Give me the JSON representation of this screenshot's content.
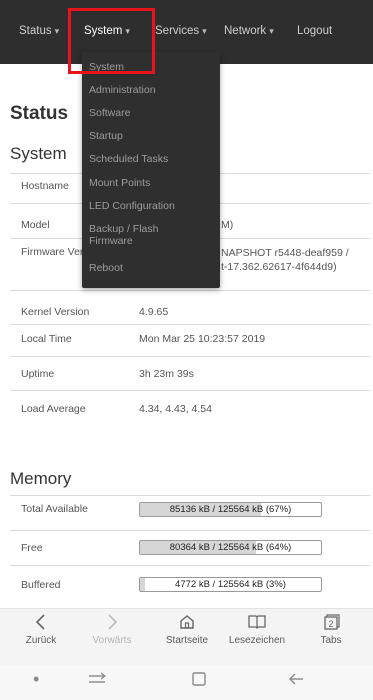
{
  "navbar": {
    "items": [
      {
        "label": "Status",
        "caret": "▾"
      },
      {
        "label": "System",
        "caret": "▾"
      },
      {
        "label": "Services",
        "caret": "▾"
      },
      {
        "label": "Network",
        "caret": "▾"
      },
      {
        "label": "Logout"
      }
    ],
    "dropdown": [
      "System",
      "Administration",
      "Software",
      "Startup",
      "Scheduled Tasks",
      "Mount Points",
      "LED Configuration",
      "Backup / Flash\nFirmware",
      "Reboot"
    ]
  },
  "page": {
    "title": "Status",
    "system": {
      "heading": "System",
      "rows": [
        {
          "label": "Hostname",
          "value": ""
        },
        {
          "label": "Model",
          "value": "M)"
        },
        {
          "label": "Firmware Version",
          "value": "NAPSHOT r5448-deaf959 /\nt-17.362.62617-4f644d9)"
        },
        {
          "label": "Kernel Version",
          "value": "4.9.65"
        },
        {
          "label": "Local Time",
          "value": "Mon Mar 25 10:23:57 2019"
        },
        {
          "label": "Uptime",
          "value": "3h 23m 39s"
        },
        {
          "label": "Load Average",
          "value": "4.34, 4.43, 4.54"
        }
      ]
    },
    "memory": {
      "heading": "Memory",
      "rows": [
        {
          "label": "Total Available",
          "text": "85136 kB / 125564 kB (67%)",
          "percent": 67
        },
        {
          "label": "Free",
          "text": "80364 kB / 125564 kB (64%)",
          "percent": 64
        },
        {
          "label": "Buffered",
          "text": "4772 kB / 125564 kB (3%)",
          "percent": 3
        }
      ]
    }
  },
  "browser_toolbar": {
    "items": [
      {
        "label": "Zurück",
        "icon": "back-icon"
      },
      {
        "label": "Vorwärts",
        "icon": "forward-icon"
      },
      {
        "label": "Startseite",
        "icon": "home-icon"
      },
      {
        "label": "Lesezeichen",
        "icon": "bookmarks-icon"
      },
      {
        "label": "Tabs",
        "icon": "tabs-icon",
        "count": "2"
      }
    ]
  },
  "android_nav": {
    "icons": [
      "dot-icon",
      "recent-apps-icon",
      "home-square-icon",
      "back-arrow-icon"
    ]
  },
  "colors": {
    "navbar": "#2e2e2e",
    "highlight": "#e8141b",
    "dropdown": "#2f2f2f"
  }
}
